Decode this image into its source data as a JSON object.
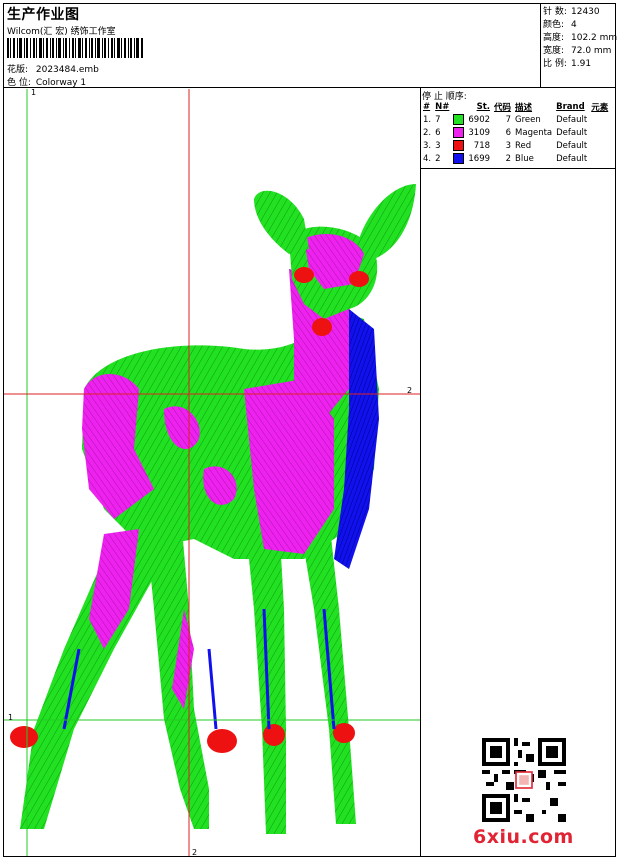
{
  "header": {
    "title": "生产作业图",
    "company": "Wilcom(汇 宏) 绣饰工作室",
    "design_label": "花版:",
    "design_value": "2023484.emb",
    "colorway_label": "色 位:",
    "colorway_value": "Colorway 1"
  },
  "stats": [
    {
      "label": "针 数:",
      "value": "12430"
    },
    {
      "label": "颜色:",
      "value": "4"
    },
    {
      "label": "高度:",
      "value": "102.2 mm"
    },
    {
      "label": "宽度:",
      "value": "72.0 mm"
    },
    {
      "label": "比 例:",
      "value": "1.91"
    }
  ],
  "stop_order": {
    "title": "停 止 顺序:",
    "columns": [
      "#",
      "N#",
      "St.",
      "代码",
      "描述",
      "Brand",
      "元素"
    ],
    "rows": [
      {
        "num": "1.",
        "n": "7",
        "color": "#22e022",
        "st": "6902",
        "code": "7",
        "desc": "Green",
        "brand": "Default"
      },
      {
        "num": "2.",
        "n": "6",
        "color": "#ee22ee",
        "st": "3109",
        "code": "6",
        "desc": "Magenta",
        "brand": "Default"
      },
      {
        "num": "3.",
        "n": "3",
        "color": "#ee1111",
        "st": "718",
        "code": "3",
        "desc": "Red",
        "brand": "Default"
      },
      {
        "num": "4.",
        "n": "2",
        "color": "#1111ee",
        "st": "1699",
        "code": "2",
        "desc": "Blue",
        "brand": "Default"
      }
    ]
  },
  "axes": {
    "green_v_label": "1",
    "green_h_label": "1",
    "red_h_label": "2",
    "red_v_label": "2"
  },
  "watermark": "6xiu.com"
}
